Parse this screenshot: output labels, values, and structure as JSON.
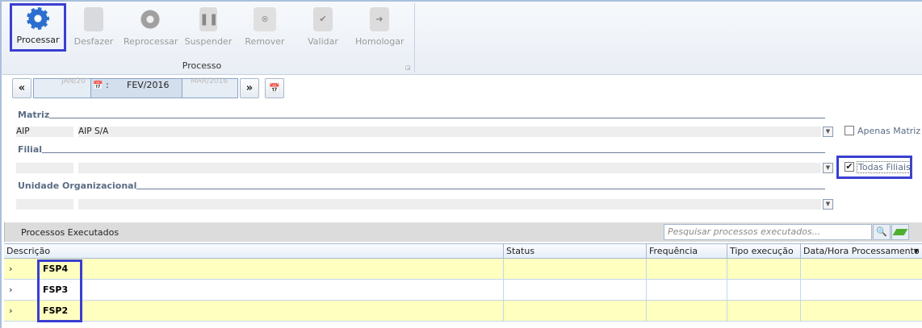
{
  "ribbon": {
    "buttons": [
      {
        "label": "Processar",
        "icon": "gear-icon",
        "enabled": true
      },
      {
        "label": "Desfazer",
        "icon": "undo-icon",
        "enabled": false
      },
      {
        "label": "Reprocessar",
        "icon": "gears-icon",
        "enabled": false
      },
      {
        "label": "Suspender",
        "icon": "pause-icon",
        "enabled": false
      },
      {
        "label": "Remover",
        "icon": "remove-icon",
        "enabled": false
      },
      {
        "label": "Validar",
        "icon": "clipboard-check-icon",
        "enabled": false
      },
      {
        "label": "Homologar",
        "icon": "clipboard-arrow-icon",
        "enabled": false
      }
    ],
    "group_label": "Processo"
  },
  "period": {
    "prev": "JAN/20",
    "current": "FEV/2016",
    "next": "MAR/2016",
    "sep": ":"
  },
  "matriz": {
    "label": "Matriz",
    "code": "AIP",
    "name": "AIP S/A",
    "only_matrix_label": "Apenas Matriz",
    "only_matrix_checked": false
  },
  "filial": {
    "label": "Filial",
    "code": "",
    "name": "",
    "all_label": "Todas Filiais",
    "all_checked": true
  },
  "unidade": {
    "label": "Unidade Organizacional",
    "code": "",
    "name": ""
  },
  "processes": {
    "title": "Processos Executados",
    "search_placeholder": "Pesquisar processos executados...",
    "columns": [
      "Descrição",
      "Status",
      "Frequência",
      "Tipo execução",
      "Data/Hora Processamento"
    ],
    "rows": [
      {
        "descricao": "FSP4"
      },
      {
        "descricao": "FSP3"
      },
      {
        "descricao": "FSP2"
      }
    ]
  },
  "colors": {
    "highlight": "#3a3fd0",
    "row_alt": "#ffffc0",
    "accent": "#5b6c85"
  }
}
